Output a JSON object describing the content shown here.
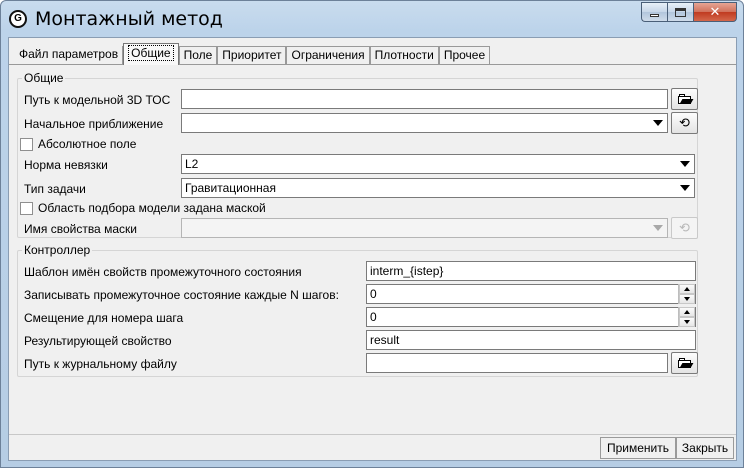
{
  "window": {
    "title": "Монтажный метод",
    "icon": "app-logo-icon",
    "icon_glyph": "G",
    "close_glyph": "✕"
  },
  "tabs": [
    {
      "label": "Файл параметров",
      "active": false
    },
    {
      "label": "Общие",
      "active": true
    },
    {
      "label": "Поле",
      "active": false
    },
    {
      "label": "Приоритет",
      "active": false
    },
    {
      "label": "Ограничения",
      "active": false
    },
    {
      "label": "Плотности",
      "active": false
    },
    {
      "label": "Прочее",
      "active": false
    }
  ],
  "general": {
    "legend": "Общие",
    "model_path_label": "Путь к модельной 3D ТОС",
    "model_path_value": "",
    "initial_approx_label": "Начальное приближение",
    "initial_approx_value": "",
    "absolute_field_label": "Абсолютное поле",
    "absolute_field_checked": false,
    "norm_label": "Норма невязки",
    "norm_value": "L2",
    "task_type_label": "Тип задачи",
    "task_type_value": "Гравитационная",
    "mask_area_label": "Область подбора модели задана маской",
    "mask_area_checked": false,
    "mask_prop_label": "Имя свойства маски",
    "mask_prop_value": ""
  },
  "controller": {
    "legend": "Контроллер",
    "template_label": "Шаблон имён свойств промежуточного состояния",
    "template_value": "interm_{istep}",
    "every_n_label": "Записывать промежуточное состояние каждые N шагов:",
    "every_n_value": "0",
    "offset_label": "Смещение для номера шага",
    "offset_value": "0",
    "result_label": "Результирующей свойство",
    "result_value": "result",
    "log_path_label": "Путь к журнальному файлу",
    "log_path_value": ""
  },
  "footer": {
    "apply_label": "Применить",
    "close_label": "Закрыть"
  },
  "icons": {
    "refresh_glyph": "⟲"
  },
  "colors": {
    "titlebar": "#bcd3ea",
    "close_button": "#c03a20",
    "client_bg": "#f0f0f0"
  }
}
